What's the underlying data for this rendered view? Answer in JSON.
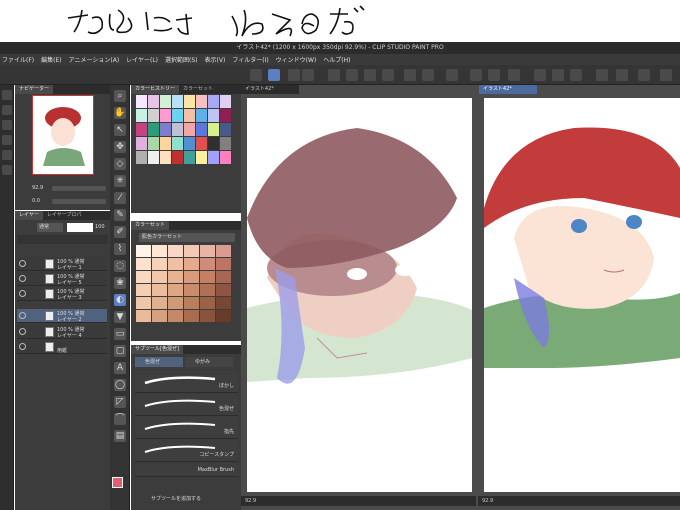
{
  "handwriting": "だめにゃ ねるのだ",
  "window": {
    "title": "イラスト42* (1200 x 1600px 350dpi 92.9%) - CLIP STUDIO PAINT PRO"
  },
  "menu": [
    "ファイル(F)",
    "編集(E)",
    "アニメーション(A)",
    "レイヤー(L)",
    "選択範囲(S)",
    "表示(V)",
    "フィルター(I)",
    "ウィンドウ(W)",
    "ヘルプ(H)"
  ],
  "navigator": {
    "title": "ナビゲーター",
    "zoom": "92.9",
    "angle": "0.0"
  },
  "layers_panel": {
    "tabs": [
      "レイヤー",
      "レイヤープロパ"
    ],
    "blend_mode": "通常",
    "opacity": "100",
    "layers": [
      {
        "line1": "100 % 通常",
        "line2": "レイヤー 1"
      },
      {
        "line1": "100 % 通常",
        "line2": "レイヤー 5"
      },
      {
        "line1": "100 % 通常",
        "line2": "レイヤー 3"
      },
      {
        "line1": "100 % 通常",
        "line2": "レイヤー 2"
      },
      {
        "line1": "100 % 通常",
        "line2": "レイヤー 4"
      },
      {
        "line1": "",
        "line2": "用紙"
      }
    ]
  },
  "color_panel": {
    "tabs": [
      "カラーヒストリー",
      "カラーセット"
    ]
  },
  "color_set": {
    "title": "カラーセット",
    "dropdown": "肌色カラーセット"
  },
  "subtool": {
    "tabs": [
      "サブツール[色混ぜ]"
    ],
    "groups": [
      "色混ぜ",
      "ゆがみ"
    ],
    "brushes": [
      "ぼかし",
      "色混ぜ",
      "指先",
      "コピースタンプ",
      "MaxBlur Brush"
    ],
    "add_label": "サブツールを追加する"
  },
  "canvas": {
    "tabs": [
      "イラスト42*",
      "イラスト42*"
    ],
    "zoom_left": "92.9",
    "zoom_right": "92.9"
  },
  "palette": {
    "history": [
      "#f7e7ff",
      "#e8c3e8",
      "#d5f0d0",
      "#b8e0f7",
      "#fce4a5",
      "#f7c1c1",
      "#a8a8f5",
      "#e0d0f0",
      "#c9f0e5",
      "#d0d0d0",
      "#ff9bd2",
      "#6ad3f2",
      "#f2c0a5",
      "#5fb0e8",
      "#bfc5f2",
      "#8f1f55",
      "#c74280",
      "#2b9e78",
      "#7e7ecc",
      "#c0c0d8",
      "#f5a5a5",
      "#5a78e0",
      "#d8f08a",
      "#4a5a88",
      "#e0b0e0",
      "#a8d8a8",
      "#ffd4a0",
      "#90e0d0",
      "#5090d0",
      "#e05050",
      "#303030",
      "#808080",
      "#b0b0b0",
      "#f0f0f0",
      "#ffe0c0",
      "#c03030",
      "#40a0a0",
      "#fff0a0",
      "#a0a0ff",
      "#ff80c0"
    ],
    "skin": [
      "#fff4ea",
      "#ffe7d6",
      "#f8d7c6",
      "#f2c9b6",
      "#e8b5a5",
      "#d89c90",
      "#fde3cf",
      "#f7d2bb",
      "#efc0a5",
      "#e3aa8e",
      "#d08c7a",
      "#bc7565",
      "#fad9c2",
      "#f3c7ab",
      "#e8b393",
      "#d99b7c",
      "#c47f65",
      "#a96652",
      "#f5cfb2",
      "#ebbd9c",
      "#dda684",
      "#c98b6b",
      "#b07055",
      "#8e5543",
      "#efc6a8",
      "#e0b08f",
      "#cf9a78",
      "#b87e5e",
      "#9a6247",
      "#7a4735",
      "#e9bb9b",
      "#d6a181",
      "#c28868",
      "#a86d50",
      "#89533c",
      "#683c2b"
    ]
  }
}
